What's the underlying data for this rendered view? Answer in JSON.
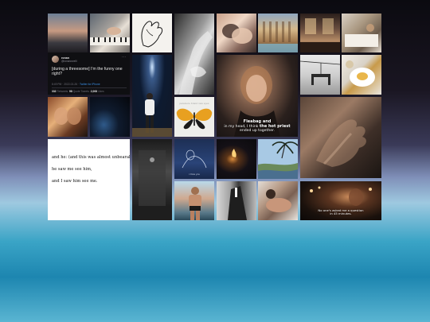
{
  "collage": {
    "tweet": {
      "name": "ronan",
      "handle": "@ronanxxrelli",
      "text": "[during a threesome] I'm the funny one right?",
      "timestamp": "8:49 PM · 2022-02-26 · ",
      "client": "Twitter for iPhone",
      "stats": [
        {
          "count": "332",
          "label": "Retweets"
        },
        {
          "count": "98",
          "label": "Quote Tweets"
        },
        {
          "count": "2,008",
          "label": "Likes"
        }
      ],
      "more_glyph": "···"
    },
    "taylor_caption": {
      "line1": "Fleabag and",
      "line2_prefix": "in my head, I think ",
      "line2_bold": "the hot priest",
      "line3": "ended up together."
    },
    "album": {
      "title": "paramore brand new eyes"
    },
    "sketch_caption": "i miss you",
    "poem": {
      "lines": [
        "and he: (and this was almost unbearable)",
        "he saw me see him,",
        "and I saw him see me."
      ]
    },
    "dinner_caption": {
      "line1": "No one's asked me a question",
      "line2": "in 45 minutes."
    }
  }
}
